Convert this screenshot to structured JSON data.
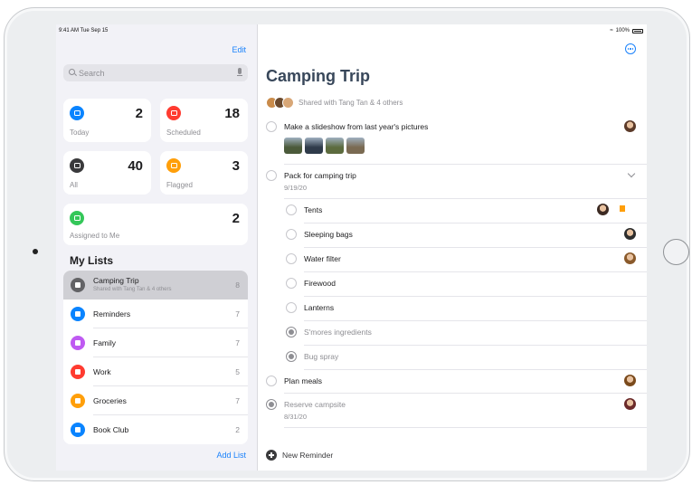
{
  "status": {
    "time": "9:41 AM  Tue Sep 15",
    "battery": "100%"
  },
  "sidebar": {
    "edit_label": "Edit",
    "search_placeholder": "Search",
    "smart_lists": [
      {
        "label": "Today",
        "count": "2",
        "color": "#0a84ff",
        "icon": "calendar-icon"
      },
      {
        "label": "Scheduled",
        "count": "18",
        "color": "#ff3b30",
        "icon": "calendar-clock-icon"
      },
      {
        "label": "All",
        "count": "40",
        "color": "#3a3a3c",
        "icon": "tray-icon"
      },
      {
        "label": "Flagged",
        "count": "3",
        "color": "#ff9f0a",
        "icon": "flag-icon"
      },
      {
        "label": "Assigned to Me",
        "count": "2",
        "color": "#34c759",
        "icon": "person-icon"
      }
    ],
    "my_lists_title": "My Lists",
    "lists": [
      {
        "name": "Camping Trip",
        "subtitle": "Shared with Tang Tan & 4 others",
        "count": "8",
        "color": "#636366",
        "icon": "flame-icon",
        "active": true
      },
      {
        "name": "Reminders",
        "subtitle": "",
        "count": "7",
        "color": "#0a84ff",
        "icon": "list-icon"
      },
      {
        "name": "Family",
        "subtitle": "",
        "count": "7",
        "color": "#bf5af2",
        "icon": "house-icon"
      },
      {
        "name": "Work",
        "subtitle": "",
        "count": "5",
        "color": "#ff3b30",
        "icon": "star-icon"
      },
      {
        "name": "Groceries",
        "subtitle": "",
        "count": "7",
        "color": "#ff9f0a",
        "icon": "cart-icon"
      },
      {
        "name": "Book Club",
        "subtitle": "",
        "count": "2",
        "color": "#0a84ff",
        "icon": "book-icon"
      }
    ],
    "add_list_label": "Add List"
  },
  "main": {
    "title": "Camping Trip",
    "shared_text": "Shared with Tang Tan & 4 others",
    "reminders": [
      {
        "title": "Make a slideshow from last year's pictures",
        "date": "",
        "indent": 0,
        "done": false,
        "person": true,
        "person_color": "#5b3a29"
      },
      {
        "title": "Pack for camping trip",
        "date": "9/19/20",
        "indent": 0,
        "done": false,
        "person": false,
        "expanded": true
      },
      {
        "title": "Tents",
        "date": "",
        "indent": 1,
        "done": false,
        "person": true,
        "person_color": "#3c2a22",
        "flagged": true
      },
      {
        "title": "Sleeping bags",
        "date": "",
        "indent": 1,
        "done": false,
        "person": true,
        "person_color": "#2d2d2d"
      },
      {
        "title": "Water filter",
        "date": "",
        "indent": 1,
        "done": false,
        "person": true,
        "person_color": "#8a5a2b"
      },
      {
        "title": "Firewood",
        "date": "",
        "indent": 1,
        "done": false,
        "person": false
      },
      {
        "title": "Lanterns",
        "date": "",
        "indent": 1,
        "done": false,
        "person": false
      },
      {
        "title": "S'mores ingredients",
        "date": "",
        "indent": 1,
        "done": true,
        "person": false
      },
      {
        "title": "Bug spray",
        "date": "",
        "indent": 1,
        "done": true,
        "person": false
      },
      {
        "title": "Plan meals",
        "date": "",
        "indent": 0,
        "done": false,
        "person": true,
        "person_color": "#7a4a1c"
      },
      {
        "title": "Reserve campsite",
        "date": "8/31/20",
        "indent": 0,
        "done": true,
        "person": true,
        "person_color": "#6b2a2a"
      }
    ],
    "new_reminder_label": "New Reminder"
  }
}
